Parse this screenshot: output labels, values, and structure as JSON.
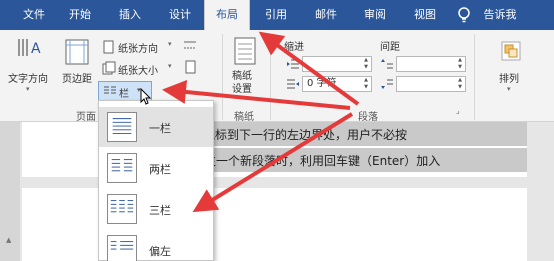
{
  "tabs": [
    {
      "label": "文件"
    },
    {
      "label": "开始"
    },
    {
      "label": "插入"
    },
    {
      "label": "设计"
    },
    {
      "label": "布局",
      "active": true
    },
    {
      "label": "引用"
    },
    {
      "label": "邮件"
    },
    {
      "label": "审阅"
    },
    {
      "label": "视图"
    }
  ],
  "tell_me": "告诉我",
  "ribbon": {
    "page_setup": {
      "text_direction": "文字方向",
      "margins": "页边距",
      "orientation": "纸张方向",
      "size": "纸张大小",
      "columns": "栏",
      "group_label": "页面"
    },
    "draft": {
      "button": "稿纸\n设置",
      "group_label": "稿纸"
    },
    "paragraph": {
      "indent_label": "缩进",
      "spacing_label": "间距",
      "indent_left": "",
      "indent_right": "0 字符",
      "spacing_before": "",
      "spacing_after": "",
      "group_label": "段落"
    },
    "arrange": {
      "label": "排列"
    }
  },
  "document": {
    "line1": "\"软回车\"使光标到下一行的左边界处，用户不必按",
    "line2": "当要产生一个新段落时，利用回车键（Enter）加入"
  },
  "columns_menu": {
    "items": [
      {
        "label": "一栏",
        "selected": true
      },
      {
        "label": "两栏"
      },
      {
        "label": "三栏"
      },
      {
        "label": "偏左"
      }
    ]
  },
  "colors": {
    "tabbar": "#2b579a",
    "arrow": "#e53a3a"
  }
}
